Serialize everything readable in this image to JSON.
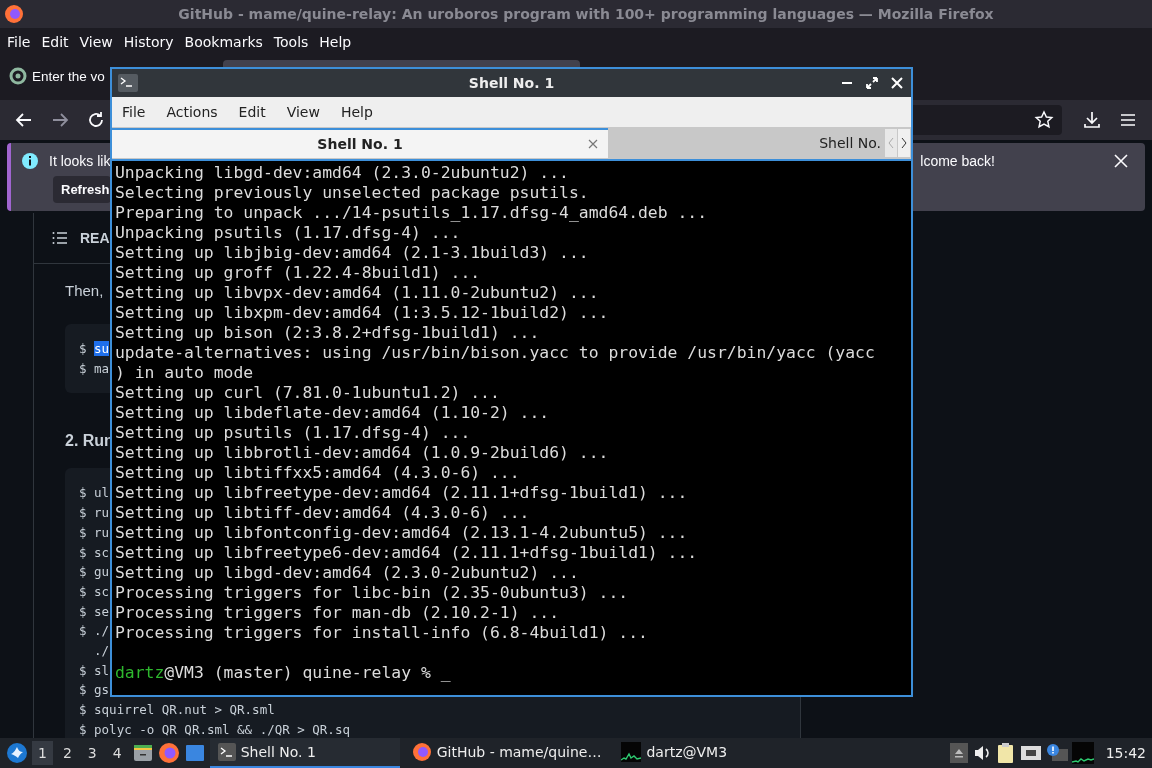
{
  "browser": {
    "title": "GitHub - mame/quine-relay: An uroboros program with 100+ programming languages — Mozilla Firefox",
    "menu": [
      "File",
      "Edit",
      "View",
      "History",
      "Bookmarks",
      "Tools",
      "Help"
    ],
    "tab_label": "Enter the vo",
    "notification": {
      "message_start": "It looks lik",
      "message_end": "lcome back!",
      "button": "Refresh"
    },
    "readme": {
      "heading": "REA",
      "intro": "Then,",
      "section_heading": "2. Run",
      "code_1": [
        {
          "prompt": "$",
          "text": "su",
          "highlighted": true
        },
        {
          "prompt": "$",
          "text": "ma",
          "highlighted": false
        }
      ],
      "code_2": [
        {
          "prompt": "$",
          "text": "ul",
          "highlighted": false
        },
        {
          "prompt": "$",
          "text": "ru",
          "highlighted": false
        },
        {
          "prompt": "$",
          "text": "ru",
          "highlighted": false
        },
        {
          "prompt": "$",
          "text": "sc",
          "highlighted": false
        },
        {
          "prompt": "$",
          "text": "gu",
          "highlighted": false
        },
        {
          "prompt": "$",
          "text": "sc",
          "highlighted": false
        },
        {
          "prompt": "$",
          "text": "se",
          "highlighted": false
        },
        {
          "prompt": "$",
          "text": "./",
          "highlighted": false
        },
        {
          "text": "./",
          "highlighted": false
        },
        {
          "prompt": "$",
          "text": "sl",
          "highlighted": false
        },
        {
          "prompt": "$",
          "text": "gs",
          "highlighted": false
        },
        {
          "prompt": "$",
          "text": "squirrel QR.nut > QR.sml",
          "highlighted": false
        },
        {
          "prompt": "$",
          "text": "polyc -o QR QR.sml && ./QR > QR.sq",
          "highlighted": false
        }
      ]
    }
  },
  "terminal": {
    "title": "Shell No. 1",
    "menu": [
      "File",
      "Actions",
      "Edit",
      "View",
      "Help"
    ],
    "tabs": [
      {
        "label": "Shell No. 1",
        "selected": true
      },
      {
        "label": "Shell No.",
        "selected": false
      }
    ],
    "lines": [
      "Unpacking libgd-dev:amd64 (2.3.0-2ubuntu2) ...",
      "Selecting previously unselected package psutils.",
      "Preparing to unpack .../14-psutils_1.17.dfsg-4_amd64.deb ...",
      "Unpacking psutils (1.17.dfsg-4) ...",
      "Setting up libjbig-dev:amd64 (2.1-3.1build3) ...",
      "Setting up groff (1.22.4-8build1) ...",
      "Setting up libvpx-dev:amd64 (1.11.0-2ubuntu2) ...",
      "Setting up libxpm-dev:amd64 (1:3.5.12-1build2) ...",
      "Setting up bison (2:3.8.2+dfsg-1build1) ...",
      "update-alternatives: using /usr/bin/bison.yacc to provide /usr/bin/yacc (yacc",
      ") in auto mode",
      "Setting up curl (7.81.0-1ubuntu1.2) ...",
      "Setting up libdeflate-dev:amd64 (1.10-2) ...",
      "Setting up psutils (1.17.dfsg-4) ...",
      "Setting up libbrotli-dev:amd64 (1.0.9-2build6) ...",
      "Setting up libtiffxx5:amd64 (4.3.0-6) ...",
      "Setting up libfreetype-dev:amd64 (2.11.1+dfsg-1build1) ...",
      "Setting up libtiff-dev:amd64 (4.3.0-6) ...",
      "Setting up libfontconfig-dev:amd64 (2.13.1-4.2ubuntu5) ...",
      "Setting up libfreetype6-dev:amd64 (2.11.1+dfsg-1build1) ...",
      "Setting up libgd-dev:amd64 (2.3.0-2ubuntu2) ...",
      "Processing triggers for libc-bin (2.35-0ubuntu3) ...",
      "Processing triggers for man-db (2.10.2-1) ...",
      "Processing triggers for install-info (6.8-4build1) ..."
    ],
    "prompt": {
      "user": "dartz",
      "rest": "@VM3 (master) quine-relay % _"
    }
  },
  "taskbar": {
    "workspaces": [
      {
        "label": "1",
        "selected": true
      },
      {
        "label": "2",
        "selected": false
      },
      {
        "label": "3",
        "selected": false
      },
      {
        "label": "4",
        "selected": false
      }
    ],
    "tasks": [
      {
        "kind": "terminal",
        "label": "Shell No. 1",
        "selected": true
      },
      {
        "kind": "browser",
        "label": "GitHub - mame/quine…",
        "selected": false
      },
      {
        "kind": "monitor",
        "label": "dartz@VM3",
        "selected": false
      }
    ],
    "clock": "15:42"
  }
}
